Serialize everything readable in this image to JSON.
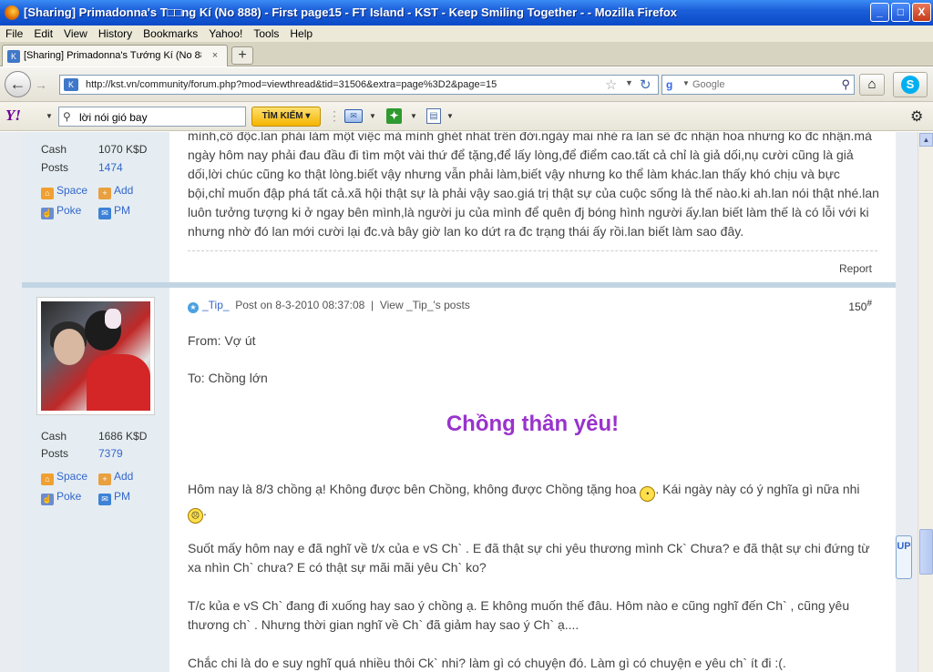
{
  "window": {
    "title": "[Sharing] Primadonna's T□□ng Kí (No 888) - First page15 - FT Island - KST - Keep Smiling Together - - Mozilla Firefox",
    "minimize": "_",
    "maximize": "□",
    "close": "X"
  },
  "menu": [
    "File",
    "Edit",
    "View",
    "History",
    "Bookmarks",
    "Yahoo!",
    "Tools",
    "Help"
  ],
  "tab": {
    "label": "[Sharing] Primadonna's Tướng Kí (No 888) - ...",
    "close": "×",
    "new_tab": "+"
  },
  "nav": {
    "url": "http://kst.vn/community/forum.php?mod=viewthread&tid=31506&extra=page%3D2&page=15",
    "search_placeholder": "Google"
  },
  "yahoo_toolbar": {
    "logo": "Y!",
    "search_value": "lời nói gió bay",
    "search_button": "TÌM KIẾM"
  },
  "post1": {
    "cash_label": "Cash",
    "cash_value": "1070 K$D",
    "posts_label": "Posts",
    "posts_value": "1474",
    "space": "Space",
    "add": "Add",
    "poke": "Poke",
    "pm": "PM",
    "lines": [
      "mình,cô độc.lan phải làm một việc mà mình ghét nhất trên đời.ngày mai nhé ra lan sẽ đc nhận hoa nhưng ko đc nhận.mà",
      "ngày hôm nay phải đau đầu đi tìm một vài thứ để tặng,để lấy lòng,để điểm cao.tất cả chỉ là giả dối,nụ cười cũng là giả",
      "dối,lời chúc cũng ko thật lòng.biết vậy nhưng vẫn phải làm,biết vậy nhưng ko thể làm khác.lan thấy khó chịu và bực",
      "bội,chỉ muốn đập phá tất cả.xã hội thật sự là phải vậy sao.giá trị thật sự của cuộc sống là thế nào.ki ah.lan nói thật nhé.lan",
      "luôn tưởng tượng ki ở ngay bên mình,là người ju của mình để quên đj bóng hình người ấy.lan biết làm thế là có lỗi với ki",
      "nhưng nhờ đó lan mới cười lại đc.và bây giờ lan ko dứt ra đc trạng thái ấy rồi.lan biết làm sao đây."
    ],
    "report": "Report"
  },
  "post2": {
    "author": "_Tip_",
    "posted_on": "Post on 8-3-2010 08:37:08",
    "view_posts": "View _Tip_'s posts",
    "number": "150",
    "number_sup": "#",
    "cash_label": "Cash",
    "cash_value": "1686 K$D",
    "posts_label": "Posts",
    "posts_value": "7379",
    "space": "Space",
    "add": "Add",
    "poke": "Poke",
    "pm": "PM",
    "from": "From: Vợ út",
    "to": "To: Chồng lớn",
    "heading": "Chồng thân yêu!",
    "p1a": "Hôm nay là 8/3 chồng ạ! Không được bên Chồng, không được Chồng tặng hoa",
    "p1b": ". Kái ngày này có ý nghĩa gì nữa nhi",
    "p1c": ".",
    "p2": "Suốt mấy hôm nay e đã nghĩ về t/x của e vS Ch` . E đã thật sự chi yêu thương mình Ck` Chưa? e đã thật sự chi đứng từ xa nhìn Ch` chưa? E có thật sự mãi mãi yêu Ch` ko?",
    "p3": "T/c kủa e vS Ch` đang đi xuống hay sao ý chồng ạ. E không muốn thế đâu. Hôm nào e cũng nghĩ đến Ch` , cũng yêu thương ch` . Nhưng thời gian nghĩ về Ch` đã giảm hay sao ý Ch` ạ....",
    "p4": "Chắc chi là do e suy nghĩ quá nhiều thôi Ck` nhi? làm gì có chuyện đó. Làm gì có chuyện e yêu ch` ít đi :(."
  },
  "uptop": "UP",
  "colors": {
    "accent": "#3366cc",
    "heading": "#9933cc",
    "sidebar": "#e5edf2"
  }
}
